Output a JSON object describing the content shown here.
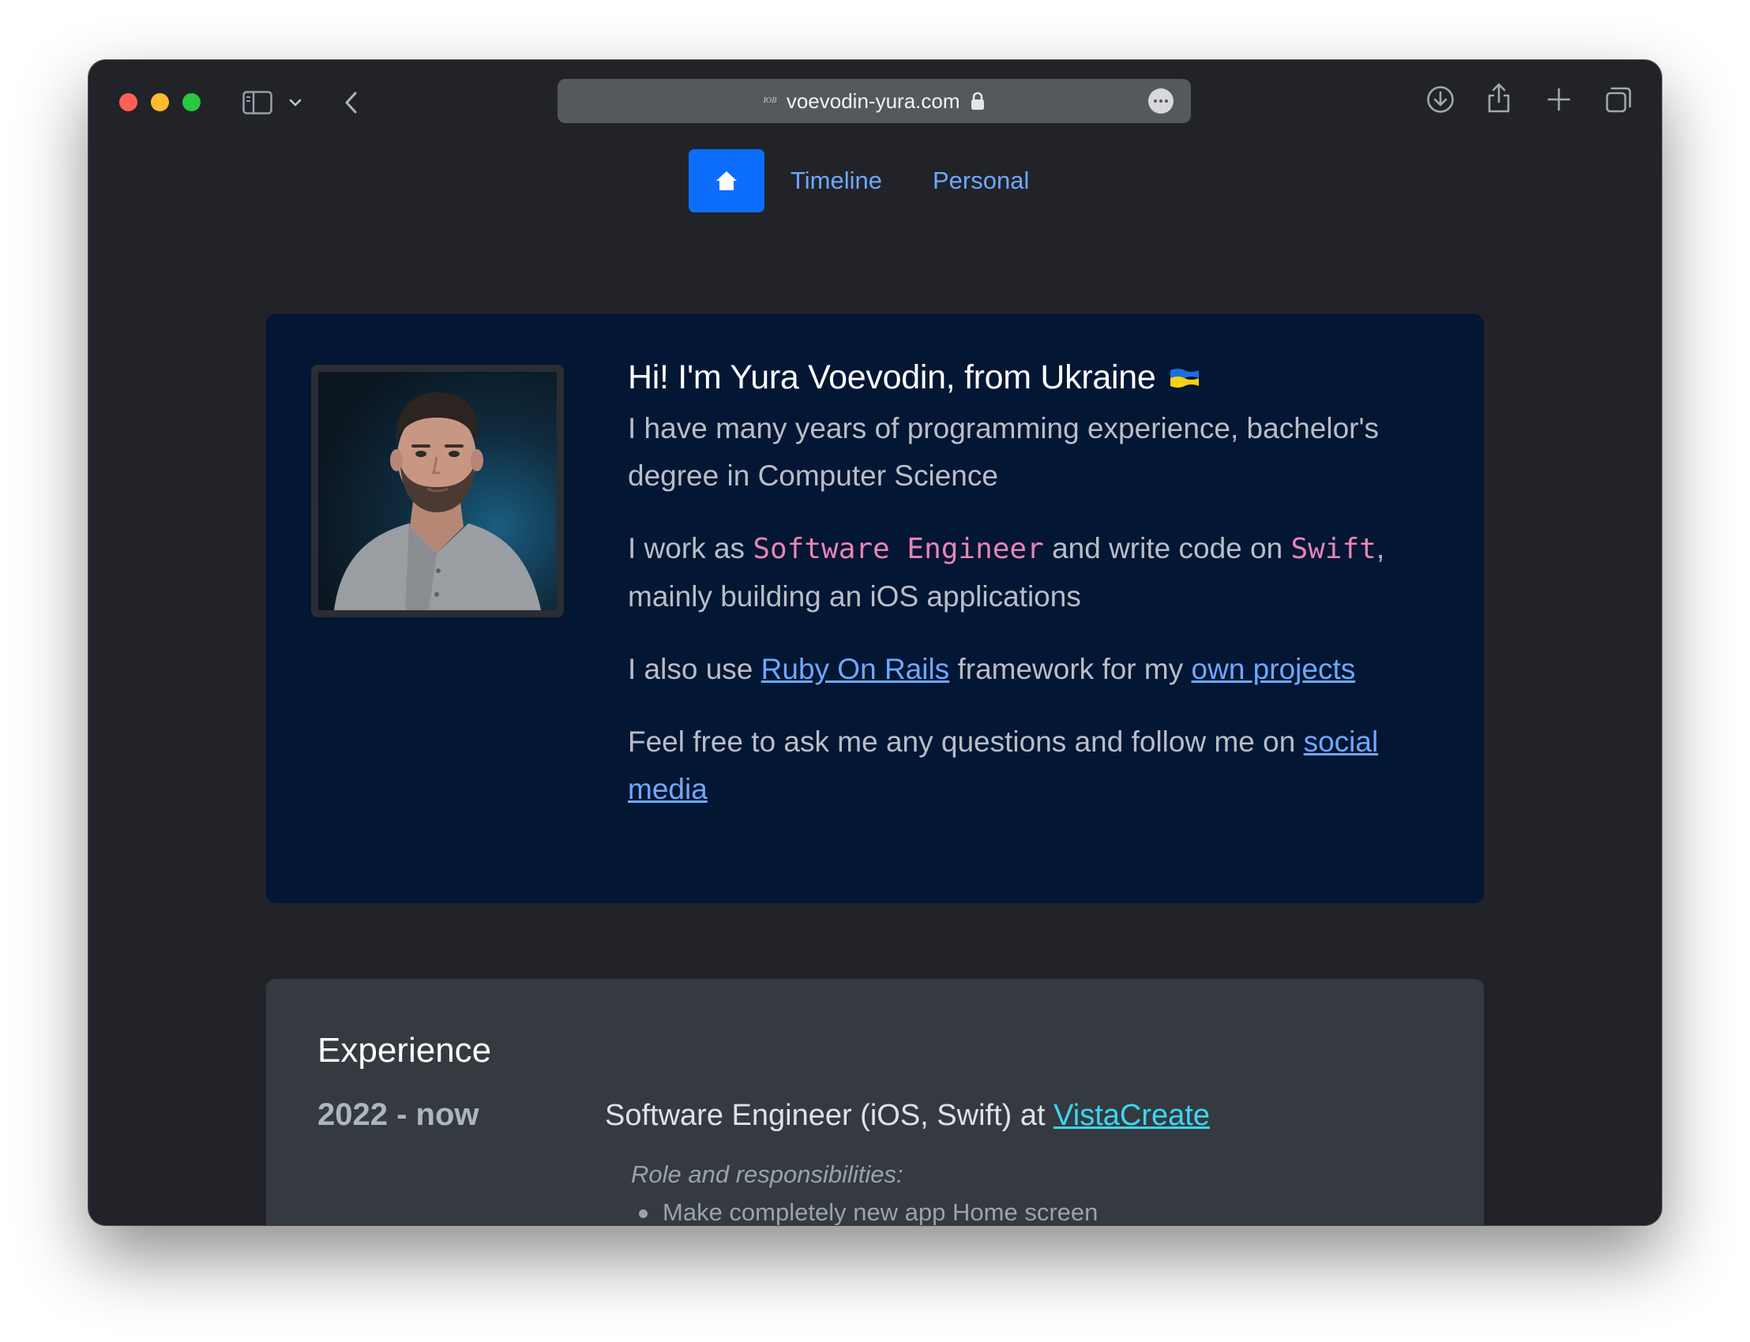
{
  "browser": {
    "url": "voevodin-yura.com",
    "favicon_text": "ЮВ",
    "colors": {
      "close": "#ff5f57",
      "minimize": "#febc2e",
      "zoom": "#28c840"
    }
  },
  "nav": {
    "home_icon": "home-icon",
    "items": [
      {
        "label": "Timeline"
      },
      {
        "label": "Personal"
      }
    ],
    "accent": "#0d6efd"
  },
  "intro": {
    "title": "Hi! I'm Yura Voevodin, from Ukraine",
    "flag_icon": "ukraine-flag-icon",
    "p1": "I have many years of programming experience, bachelor's degree in Computer Science",
    "p2_a": "I work as ",
    "p2_code1": "Software Engineer",
    "p2_b": " and write code on ",
    "p2_code2": "Swift",
    "p2_c": ", mainly building an iOS applications",
    "p3_a": "I also use ",
    "p3_link1": "Ruby On Rails",
    "p3_b": " framework for my ",
    "p3_link2": "own projects",
    "p4_a": "Feel free to ask me any questions and follow me on ",
    "p4_link": "social media"
  },
  "experience": {
    "title": "Experience",
    "entries": [
      {
        "years": "2022 - now",
        "role": "Software Engineer (iOS, Swift) at ",
        "company": "VistaCreate",
        "subtitle": "Role and responsibilities:",
        "items": [
          "Make completely new app Home screen"
        ]
      }
    ]
  }
}
